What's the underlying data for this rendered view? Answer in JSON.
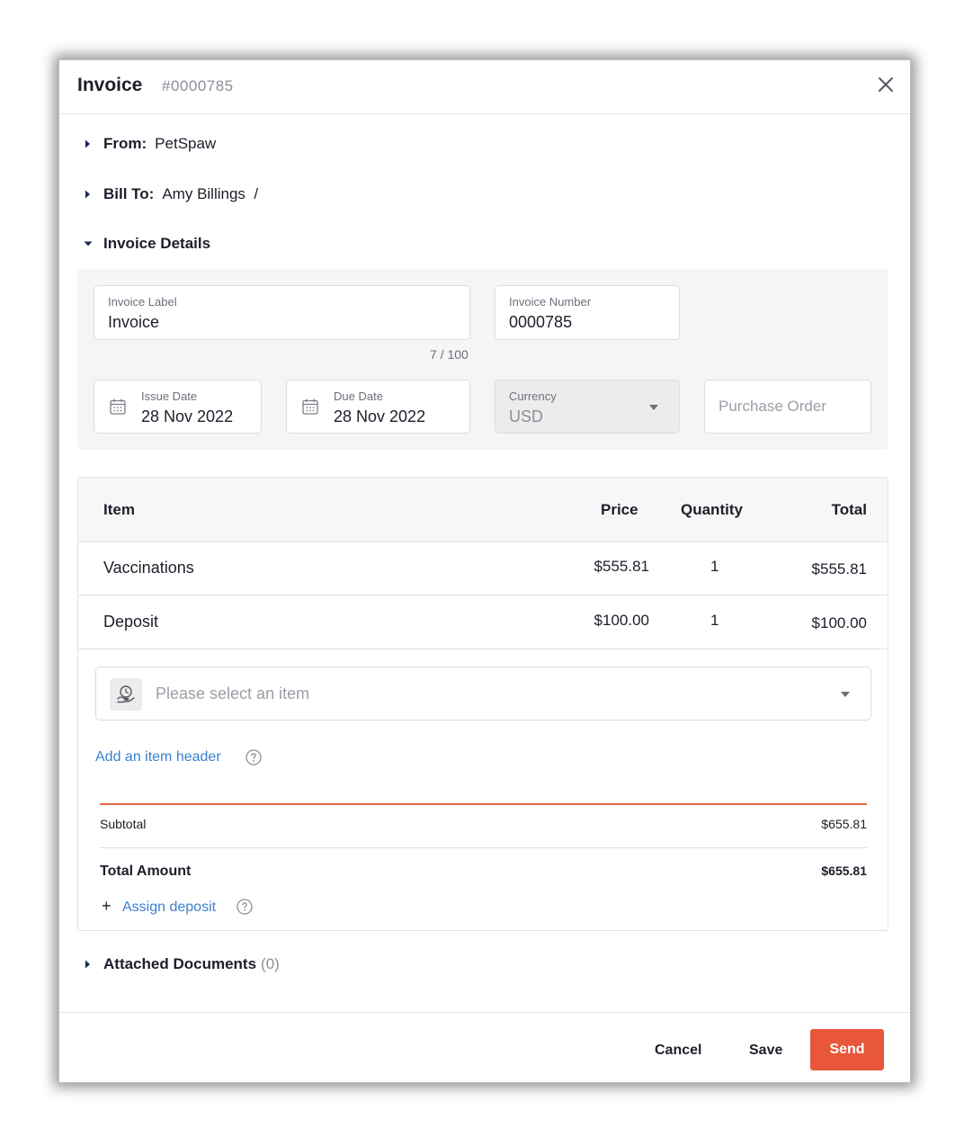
{
  "modal": {
    "title": "Invoice",
    "number": "#0000785"
  },
  "sections": {
    "from_label": "From:",
    "from_value": "PetSpaw",
    "bill_to_label": "Bill To:",
    "bill_to_value": "Amy Billings  /",
    "details_label": "Invoice Details",
    "attached_label": "Attached Documents",
    "attached_count": "(0)"
  },
  "details": {
    "invoice_label": {
      "label": "Invoice Label",
      "value": "Invoice",
      "counter": "7 / 100"
    },
    "invoice_number": {
      "label": "Invoice Number",
      "value": "0000785"
    },
    "issue_date": {
      "label": "Issue Date",
      "value": "28 Nov 2022"
    },
    "due_date": {
      "label": "Due Date",
      "value": "28 Nov 2022"
    },
    "currency": {
      "label": "Currency",
      "value": "USD"
    },
    "purchase_order": {
      "placeholder": "Purchase Order"
    }
  },
  "table": {
    "headers": {
      "item": "Item",
      "price": "Price",
      "quantity": "Quantity",
      "total": "Total"
    },
    "rows": [
      {
        "item": "Vaccinations",
        "price": "$555.81",
        "quantity": "1",
        "total": "$555.81"
      },
      {
        "item": "Deposit",
        "price": "$100.00",
        "quantity": "1",
        "total": "$100.00"
      }
    ],
    "select_placeholder": "Please select an item",
    "add_header_link": "Add an item header"
  },
  "totals": {
    "subtotal_label": "Subtotal",
    "subtotal_value": "$655.81",
    "total_label": "Total Amount",
    "total_value": "$655.81",
    "assign_deposit_plus": "+",
    "assign_deposit_link": "Assign deposit"
  },
  "footer": {
    "cancel": "Cancel",
    "save": "Save",
    "send": "Send"
  },
  "icons": {
    "close": "close-icon",
    "caret_right": "caret-right-icon",
    "caret_down": "caret-down-icon",
    "calendar": "calendar-icon",
    "item_picker": "item-picker-icon",
    "help": "help-icon",
    "dropdown": "chevron-down-icon"
  },
  "colors": {
    "accent": "#e8573a",
    "link": "#3b7fcf",
    "panel_bg": "#f5f5f5",
    "divider_accent": "#e06a45"
  }
}
